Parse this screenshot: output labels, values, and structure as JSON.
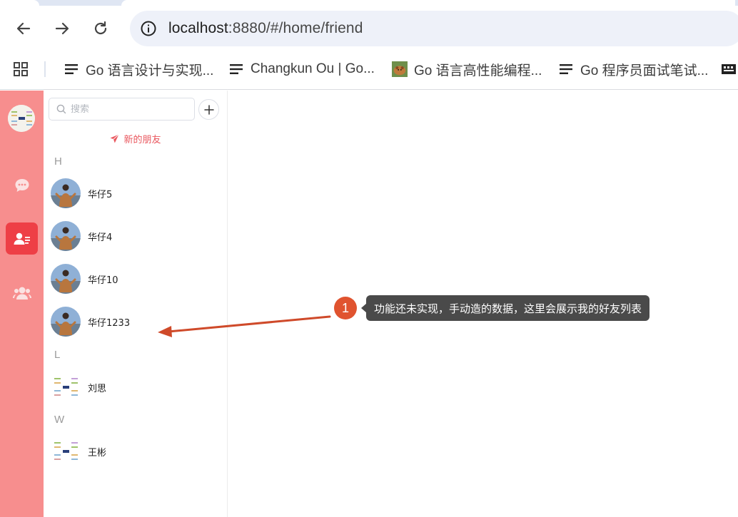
{
  "browser": {
    "url_host": "localhost",
    "url_path": ":8880/#/home/friend",
    "bookmarks": [
      {
        "label": "Go 语言设计与实现...",
        "icon": "page-lines-icon"
      },
      {
        "label": "Changkun Ou | Go...",
        "icon": "page-lines-icon"
      },
      {
        "label": "Go 语言高性能编程...",
        "icon": "hamster-favicon"
      },
      {
        "label": "Go 程序员面试笔试...",
        "icon": "page-lines-icon"
      }
    ]
  },
  "sidebar_rail": {
    "items": [
      {
        "name": "chat",
        "icon": "chat-bubble-icon"
      },
      {
        "name": "contacts",
        "icon": "contacts-icon",
        "active": true
      },
      {
        "name": "groups",
        "icon": "group-icon"
      }
    ],
    "active_color": "#ee3f46",
    "rail_color": "#f78e8e"
  },
  "friends_panel": {
    "search_placeholder": "搜索",
    "new_friend_label": "新的朋友",
    "groups": [
      {
        "letter": "H",
        "friends": [
          {
            "name": "华仔5",
            "avatar": "photo"
          },
          {
            "name": "华仔4",
            "avatar": "photo"
          },
          {
            "name": "华仔10",
            "avatar": "photo"
          },
          {
            "name": "华仔1233",
            "avatar": "photo"
          }
        ]
      },
      {
        "letter": "L",
        "friends": [
          {
            "name": "刘思",
            "avatar": "mindmap"
          }
        ]
      },
      {
        "letter": "W",
        "friends": [
          {
            "name": "王彬",
            "avatar": "mindmap"
          }
        ]
      }
    ]
  },
  "annotation": {
    "number": "1",
    "text": "功能还未实现，手动造的数据，这里会展示我的好友列表",
    "color": "#e0532f"
  }
}
